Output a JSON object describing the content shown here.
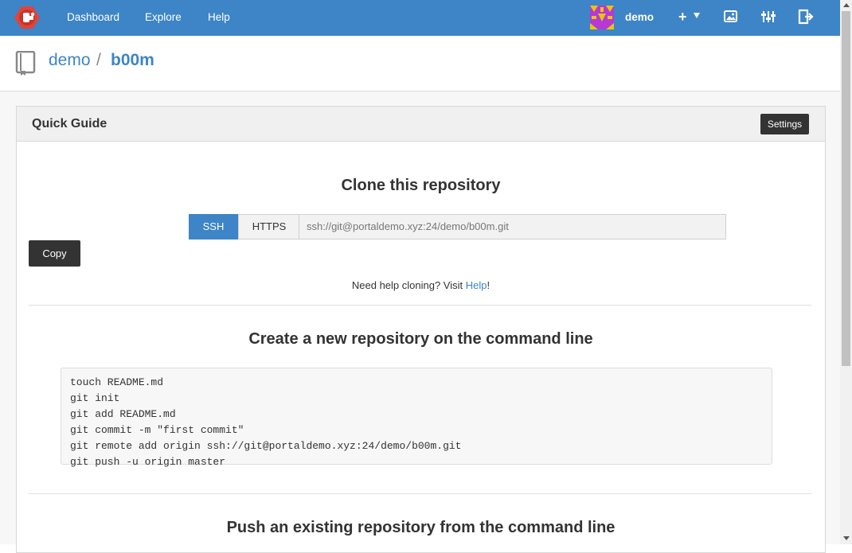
{
  "nav": {
    "links": [
      "Dashboard",
      "Explore",
      "Help"
    ],
    "user": "demo",
    "icons": [
      "gogs-logo-icon",
      "user-avatar",
      "plus-icon",
      "caret-down-icon",
      "image-icon",
      "settings-sliders-icon",
      "sign-out-icon"
    ],
    "accent_color": "#3d85c6"
  },
  "breadcrumb": {
    "owner": "demo",
    "separator": "/",
    "repo": "b00m"
  },
  "panel": {
    "title": "Quick Guide",
    "settings_label": "Settings"
  },
  "clone": {
    "title": "Clone this repository",
    "ssh_label": "SSH",
    "https_label": "HTTPS",
    "url": "ssh://git@portaldemo.xyz:24/demo/b00m.git",
    "copy_label": "Copy",
    "help_prefix": "Need help cloning? Visit ",
    "help_link": "Help",
    "help_suffix": "!"
  },
  "create": {
    "title": "Create a new repository on the command line",
    "code": [
      "touch README.md",
      "git init",
      "git add README.md",
      "git commit -m \"first commit\"",
      "git remote add origin ssh://git@portaldemo.xyz:24/demo/b00m.git",
      "git push -u origin master"
    ]
  },
  "push": {
    "title": "Push an existing repository from the command line"
  }
}
